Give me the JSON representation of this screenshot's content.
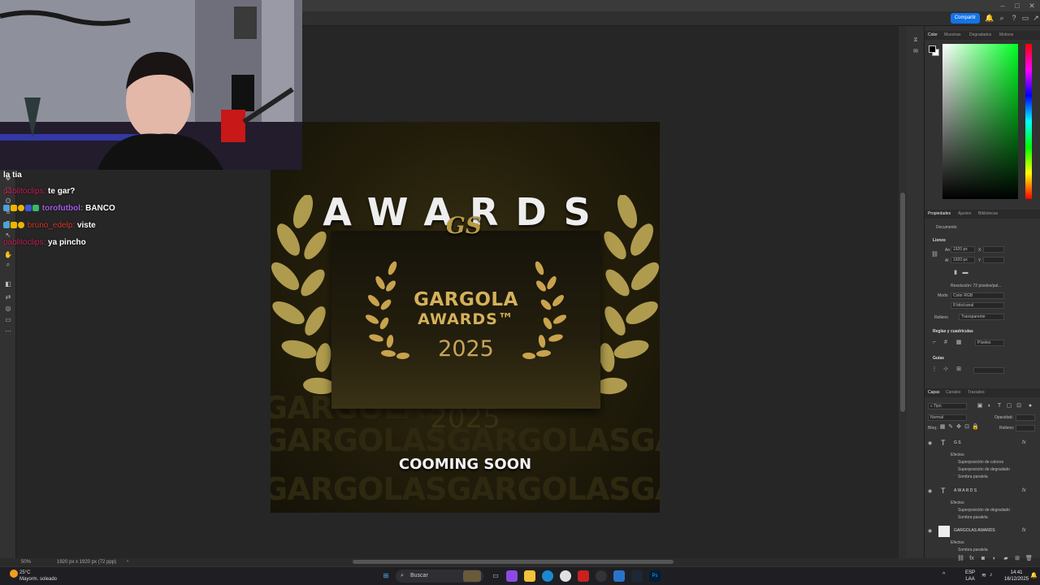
{
  "app": {
    "share_label": "Compartir"
  },
  "chat": {
    "lines": [
      {
        "user": "",
        "message": "la tia"
      },
      {
        "user": "pablitoclips:",
        "message": "te gar?"
      },
      {
        "user": "torofutbol:",
        "message": "BANCO"
      },
      {
        "user": "bruno_edelp:",
        "message": "viste"
      },
      {
        "user": "pablitoclips:",
        "message": "ya pincho"
      }
    ]
  },
  "artboard": {
    "title": "AWARDS",
    "logo_text": "GS",
    "card_line1": "GARGOLA",
    "card_line2": "AWARDS™",
    "card_year": "2025",
    "ghost_year": "2025",
    "footer": "COOMING SOON",
    "watermark": [
      "GARGOLAS",
      "GARGOLASGARGOLASGAR",
      "GARGOLASGARGOLASGAR"
    ]
  },
  "status_bar": {
    "zoom": "50%",
    "doc_info": "1920 px x 1920 px (72 ppp)"
  },
  "panels": {
    "color_tabs": [
      "Color",
      "Muestras",
      "Degradados",
      "Motivos"
    ],
    "properties_tabs": [
      "Propiedades",
      "Ajustes",
      "Bibliotecas"
    ],
    "document_label": "Documento",
    "canvas_section": "Lienzo",
    "width_label": "An",
    "width_value": "1920 px",
    "height_label": "Al",
    "height_value": "1920 px",
    "x_label": "X",
    "y_label": "Y",
    "resolution": "Resolución: 72 píxeles/pul...",
    "mode_label": "Modo",
    "mode_value": "Color RGB",
    "depth_value": "8 bits/canal",
    "fill_label": "Relleno",
    "fill_value": "Transparente",
    "rulers_section": "Reglas y cuadrículas",
    "units_value": "Píxeles",
    "guides_section": "Guías",
    "layers_tabs": [
      "Capas",
      "Canales",
      "Trazados"
    ],
    "layer_filter": "Tipo",
    "blend_mode": "Normal",
    "opacity_label": "Opacidad:",
    "lock_label": "Bloq.:",
    "fill_opacity_label": "Relleno:",
    "layers": [
      {
        "name": "G S",
        "effects": [
          "Superposición de colores",
          "Superposición de degradado",
          "Sombra paralela"
        ]
      },
      {
        "name": "A W A R D S",
        "effects": [
          "Superposición de degradado",
          "Sombra paralela"
        ]
      },
      {
        "name": "GARGOLAS AWARDS",
        "effects": [
          "Sombra paralela"
        ]
      }
    ],
    "effects_label": "Efectos",
    "fx_label": "fx"
  },
  "taskbar": {
    "weather_temp": "25°C",
    "weather_desc": "Mayorm. soleado",
    "search_placeholder": "Buscar",
    "lang_line1": "ESP",
    "lang_line2": "LAA",
    "time": "14:41",
    "date": "16/12/2025"
  },
  "colors": {
    "accent": "#1473e6",
    "gold": "#d4b15a",
    "chat_user": "#c0235a"
  }
}
